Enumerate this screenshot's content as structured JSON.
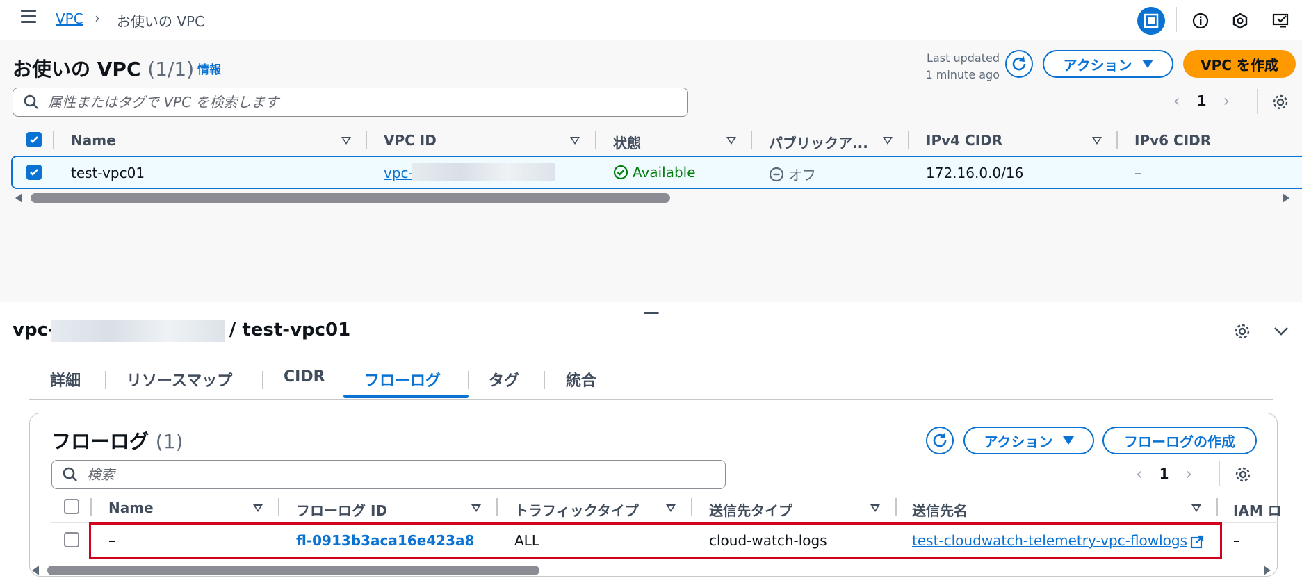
{
  "breadcrumb": {
    "root": "VPC",
    "current": "お使いの VPC"
  },
  "vpc_list": {
    "title": "お使いの VPC",
    "count": "(1/1)",
    "info_label": "情報",
    "last_updated_line1": "Last updated",
    "last_updated_line2": "1 minute ago",
    "actions_label": "アクション",
    "create_label": "VPC を作成",
    "search_placeholder": "属性またはタグで VPC を検索します",
    "page": "1",
    "columns": [
      "Name",
      "VPC ID",
      "状態",
      "パブリックア...",
      "IPv4 CIDR",
      "IPv6 CIDR"
    ],
    "row": {
      "name": "test-vpc01",
      "vpc_id": "vpc-",
      "status": "Available",
      "public": "オフ",
      "ipv4": "172.16.0.0/16",
      "ipv6": "–"
    }
  },
  "detail": {
    "title_prefix": "vpc-",
    "title_suffix": "/ test-vpc01",
    "tabs": [
      "詳細",
      "リソースマップ",
      "CIDR",
      "フローログ",
      "タグ",
      "統合"
    ],
    "active_tab": "フローログ"
  },
  "flowlogs": {
    "title": "フローログ",
    "count": "(1)",
    "actions_label": "アクション",
    "create_label": "フローログの作成",
    "search_placeholder": "検索",
    "page": "1",
    "columns": [
      "Name",
      "フローログ ID",
      "トラフィックタイプ",
      "送信先タイプ",
      "送信先名",
      "IAM ロ"
    ],
    "row": {
      "name": "–",
      "id": "fl-0913b3aca16e423a8",
      "traffic": "ALL",
      "dest_type": "cloud-watch-logs",
      "dest_name": "test-cloudwatch-telemetry-vpc-flowlogs",
      "iam": "–"
    }
  },
  "colors": {
    "accent": "#0972d3",
    "primary": "#ff9900",
    "success": "#037f0c",
    "highlight": "#d0021b"
  }
}
